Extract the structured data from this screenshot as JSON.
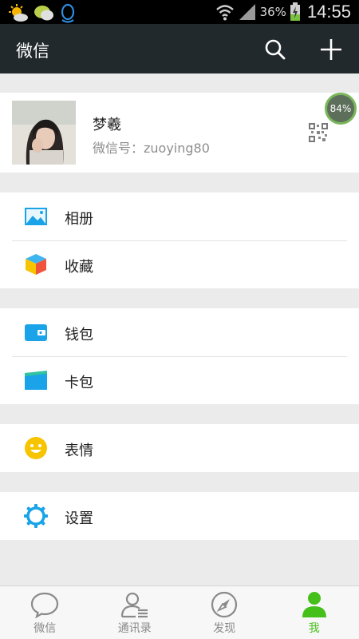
{
  "status_bar": {
    "battery_percent": "36%",
    "time": "14:55"
  },
  "header": {
    "title": "微信",
    "icons": [
      "search-icon",
      "plus-icon"
    ]
  },
  "profile": {
    "nickname": "梦羲",
    "wechat_id": "微信号：zuoying80",
    "badge": "84%"
  },
  "menu": {
    "album": "相册",
    "favorites": "收藏",
    "wallet": "钱包",
    "cards": "卡包",
    "stickers": "表情",
    "settings": "设置"
  },
  "tabs": [
    {
      "label": "微信",
      "icon": "chat-bubble-icon",
      "active": false
    },
    {
      "label": "通讯录",
      "icon": "contacts-icon",
      "active": false
    },
    {
      "label": "发现",
      "icon": "compass-icon",
      "active": false
    },
    {
      "label": "我",
      "icon": "person-icon",
      "active": true
    }
  ],
  "colors": {
    "title_bar": "#22292c",
    "accent_green": "#45c01a",
    "icon_blue": "#1aa3e8",
    "icon_yellow": "#f7c400"
  }
}
